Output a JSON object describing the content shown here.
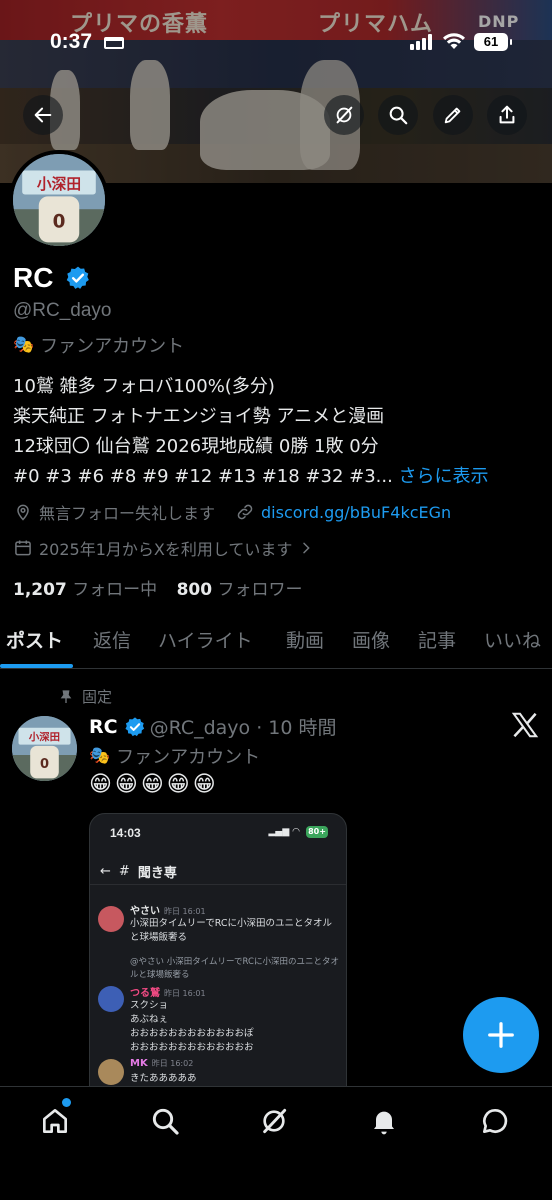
{
  "status_bar": {
    "time": "0:37",
    "battery": "61"
  },
  "banner": {
    "ad_left": "プリマの香薫",
    "ad_right": "プリマハム",
    "ad_far": "DNP"
  },
  "header": {
    "back_icon": "arrow-left-icon",
    "grok_icon": "grok-icon",
    "search_icon": "search-icon",
    "edit_icon": "pencil-icon",
    "share_icon": "share-icon"
  },
  "profile": {
    "display_name": "RC",
    "handle": "@RC_dayo",
    "label": "ファンアカウント",
    "bio_lines": [
      "10鷲 雑多 フォロバ100%(多分)",
      "楽天純正 フォトナエンジョイ勢 アニメと漫画",
      "12球団〇 仙台鷲 2026現地成績 0勝 1敗 0分",
      "#0 #3 #6 #8 #9 #12 #13 #18 #32 #3..."
    ],
    "show_more": "さらに表示",
    "description_meta": "無言フォロー失礼します",
    "link": "discord.gg/bBuF4kcEGn",
    "joined": "2025年1月からXを利用しています",
    "following_count": "1,207",
    "following_label": "フォロー中",
    "followers_count": "800",
    "followers_label": "フォロワー"
  },
  "tabs": [
    "ポスト",
    "返信",
    "ハイライト",
    "動画",
    "画像",
    "記事",
    "いいね"
  ],
  "post": {
    "pinned_label": "固定",
    "name": "RC",
    "handle_time": "@RC_dayo · 10 時間",
    "label": "ファンアカウント",
    "text": "😁😁😁😁😁",
    "screenshot": {
      "time": "14:03",
      "battery": "80+",
      "channel": "聞き専",
      "messages": [
        {
          "name": "やさい",
          "date": "昨日 16:01",
          "text": "小深田タイムリーでRCに小深田のユニとタオルと球場飯奢る",
          "color": "#e7e9ea"
        },
        {
          "name": "つる鷲",
          "date": "昨日 16:01",
          "text": "スクショ\nあぶねぇ\nおおおおおおおおおおおおぽ\nおおおおおおおおおおおおお",
          "color": "#f04a83"
        },
        {
          "name": "MK",
          "date": "昨日 16:02",
          "text": "きたあああああ",
          "color": "#e67ce7"
        }
      ],
      "reply_preview": "@やさい 小深田タイムリーでRCに小深田のユニとタオルと球場飯奢る"
    }
  },
  "nav": [
    "home-icon",
    "search-icon",
    "grok-icon",
    "bell-icon",
    "message-icon"
  ],
  "colors": {
    "accent": "#1d9bf0",
    "background": "#000000",
    "muted": "#71767b"
  }
}
